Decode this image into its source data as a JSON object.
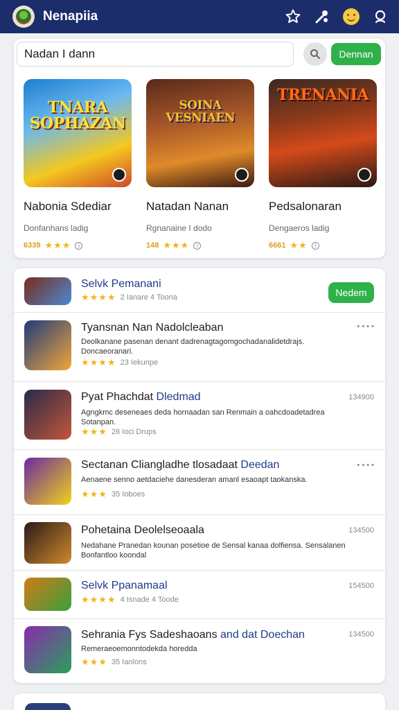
{
  "app": {
    "title": "Nenapiia"
  },
  "topbar": {
    "icons": [
      "star-icon",
      "tools-icon",
      "smiley-icon",
      "user-icon"
    ]
  },
  "search": {
    "value": "Nadan I dann",
    "button_label": "Dennan"
  },
  "featured": [
    {
      "name": "Nabonia Sdediar",
      "subtitle": "Donfanhans ladig",
      "count": "6339",
      "stars": "★★★",
      "art_title": "TNARA SOPHAZAN",
      "colors": [
        "#1d7fd0",
        "#f4c81f"
      ]
    },
    {
      "name": "Natadan Nanan",
      "subtitle": "Rgnanaine I dodo",
      "count": "148",
      "stars": "★★★",
      "art_title": "SOINA VESNIAEN",
      "colors": [
        "#5a2a1a",
        "#e08a2a"
      ]
    },
    {
      "name": "Pedsalonaran",
      "subtitle": "Dengaeros ladig",
      "count": "6661",
      "stars": "★★",
      "art_title": "TRENANIA",
      "colors": [
        "#3a2a22",
        "#d44a1a"
      ]
    }
  ],
  "list": [
    {
      "title": "Selvk Pemanani",
      "title_blue": true,
      "stars": "★★★★",
      "meta": "2 Ianare 4 Toona",
      "button_label": "Nedem",
      "colors": [
        "#7a2a1c",
        "#4a8ad0"
      ]
    },
    {
      "title": "Tyansnan Nan Nadolcleaban",
      "desc": "Deolkanane pasenan denant dadrenagtagomgochadanalidetdrajs. Doncaeoranari.",
      "stars": "★★★★",
      "meta": "23 Iekunpe",
      "right": "• • • •",
      "colors": [
        "#1e3b7a",
        "#f2a63a"
      ]
    },
    {
      "title": "Pyat Phachdat",
      "title_blue_part": "Dledmad",
      "desc": "Agngkmc deseneaes deda hornaadan san Renmain a oahcdoadetadrea Sotanpan.",
      "stars": "★★★",
      "meta": "26 Ioci Drups",
      "right": "134900",
      "colors": [
        "#2a2a4a",
        "#c4563a"
      ]
    },
    {
      "title": "Sectanan Cliangladhe tlosadaat",
      "title_blue_part": "Deedan",
      "desc": "Aenaene senno aetdaciehe danesderan amanl esaoapt taokanska.",
      "stars": "★★★",
      "meta": "35 Ioboes",
      "right": "• • • •",
      "colors": [
        "#6a2aa0",
        "#f2d21a"
      ]
    },
    {
      "title": "Pohetaina Deolelseoaala",
      "desc": "Nedahane Pranedan kounan posetioe de Sensal kanaa dolfiensa. Sensalanen Bonfantloo koondal",
      "stars": "",
      "meta": "",
      "right": "134500",
      "colors": [
        "#2a1a1a",
        "#d08a2a"
      ]
    },
    {
      "title": "Selvk Ppanamaal",
      "title_blue": true,
      "stars": "★★★★",
      "meta": "4 Isnade 4 Toode",
      "right": "154500",
      "colors": [
        "#d07a1a",
        "#3aa03a"
      ]
    },
    {
      "title": "Sehrania Fys Sadeshaoans",
      "title_blue_part": "and dat Doechan",
      "desc": "Remeraeoemonntodekda horedda",
      "stars": "★★★",
      "meta": "35 Ianlons",
      "right": "134500",
      "colors": [
        "#8a2ab0",
        "#2aa05a"
      ]
    }
  ]
}
